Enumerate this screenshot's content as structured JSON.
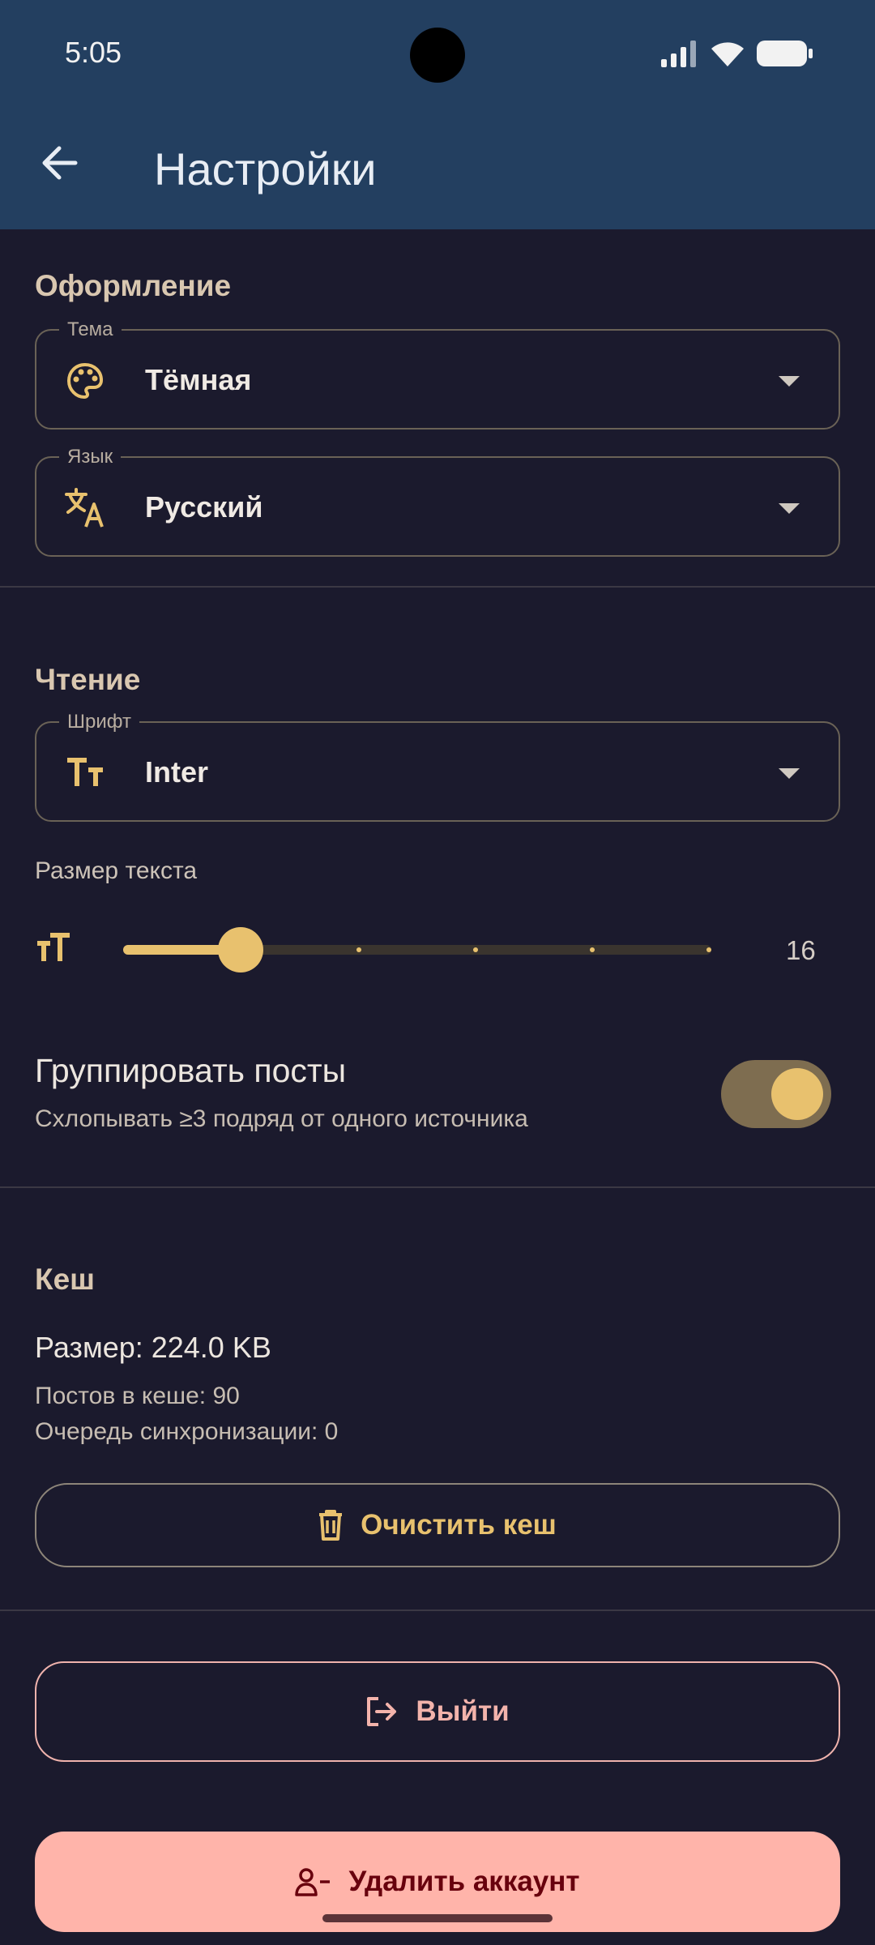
{
  "status_bar": {
    "time": "5:05"
  },
  "app_bar": {
    "title": "Настройки"
  },
  "appearance": {
    "section_title": "Оформление",
    "theme": {
      "label": "Тема",
      "value": "Тёмная",
      "icon": "palette-icon"
    },
    "language": {
      "label": "Язык",
      "value": "Русский",
      "icon": "translate-icon"
    }
  },
  "reading": {
    "section_title": "Чтение",
    "font": {
      "label": "Шрифт",
      "value": "Inter",
      "icon": "text-fields-icon"
    },
    "text_size": {
      "label": "Размер текста",
      "value": "16",
      "position_fraction": 0.2,
      "steps": 5
    },
    "group_posts": {
      "title": "Группировать посты",
      "subtitle": "Схлопывать ≥3 подряд от одного источника",
      "enabled": true
    }
  },
  "cache": {
    "section_title": "Кеш",
    "size": "Размер: 224.0 KB",
    "posts": "Постов в кеше: 90",
    "sync_queue": "Очередь синхронизации: 0",
    "clear_label": "Очистить кеш"
  },
  "account": {
    "logout_label": "Выйти",
    "delete_label": "Удалить аккаунт"
  },
  "colors": {
    "accent": "#e8c16e",
    "background": "#1b1a2d",
    "app_bar": "#233f60",
    "danger": "#ffb4aa"
  }
}
